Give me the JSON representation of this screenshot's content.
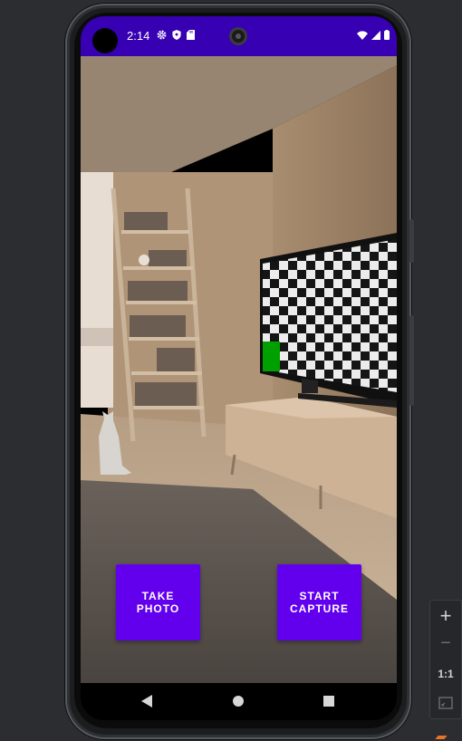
{
  "status_bar": {
    "time": "2:14",
    "left_icons": [
      "gear-icon",
      "shield-icon",
      "sd-card-icon"
    ],
    "right_icons": [
      "wifi-icon",
      "signal-icon",
      "battery-icon"
    ],
    "color": "#3700b3"
  },
  "buttons": {
    "take_photo": "TAKE\nPHOTO",
    "start_capture": "START\nCAPTURE",
    "color": "#6200ee"
  },
  "navigation": [
    "back-icon",
    "home-icon",
    "recents-icon"
  ],
  "emulator_toolbar": {
    "zoom_in": "+",
    "zoom_out": "−",
    "actual_size": "1:1",
    "fit_icon": "fit-screen-icon"
  }
}
